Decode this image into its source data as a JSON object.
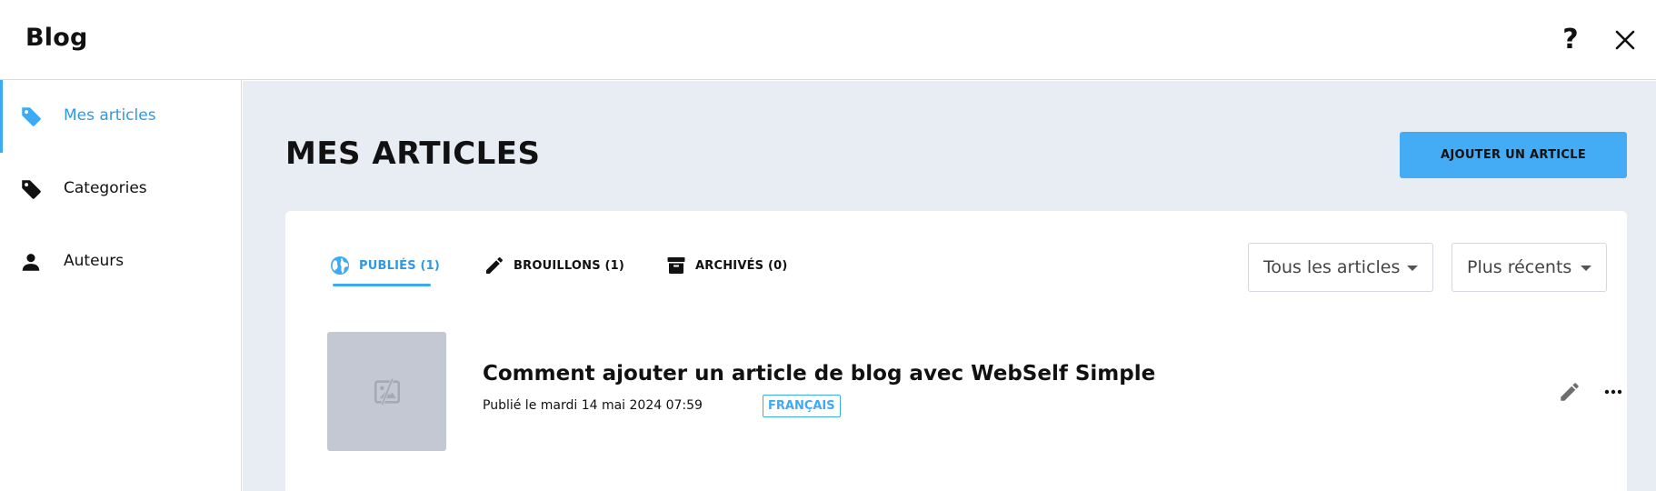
{
  "header": {
    "title": "Blog",
    "help_icon": "help-icon",
    "close_icon": "close-icon"
  },
  "sidebar": {
    "items": [
      {
        "label": "Mes articles",
        "icon": "tag-icon",
        "active": true
      },
      {
        "label": "Categories",
        "icon": "tag-icon",
        "active": false
      },
      {
        "label": "Auteurs",
        "icon": "person-icon",
        "active": false
      }
    ]
  },
  "main": {
    "title": "MES ARTICLES",
    "add_button_label": "AJOUTER UN ARTICLE",
    "tabs": [
      {
        "label": "PUBLIÉS (1)",
        "icon": "globe-icon",
        "active": true
      },
      {
        "label": "BROUILLONS (1)",
        "icon": "pencil-icon",
        "active": false
      },
      {
        "label": "ARCHIVÉS (0)",
        "icon": "archive-icon",
        "active": false
      }
    ],
    "filters": {
      "scope": "Tous les articles",
      "sort": "Plus récents"
    },
    "articles": [
      {
        "title": "Comment ajouter un article de blog avec WebSelf Simple",
        "published": "Publié le mardi 14 mai 2024 07:59",
        "language": "FRANÇAIS",
        "thumbnail_icon": "image-placeholder-icon"
      }
    ]
  },
  "colors": {
    "accent": "#3daaf5",
    "accent_text": "#3199e0",
    "button_bg": "#44abf5",
    "main_bg": "#e8ecf3",
    "thumb_bg": "#c4c8d2"
  }
}
